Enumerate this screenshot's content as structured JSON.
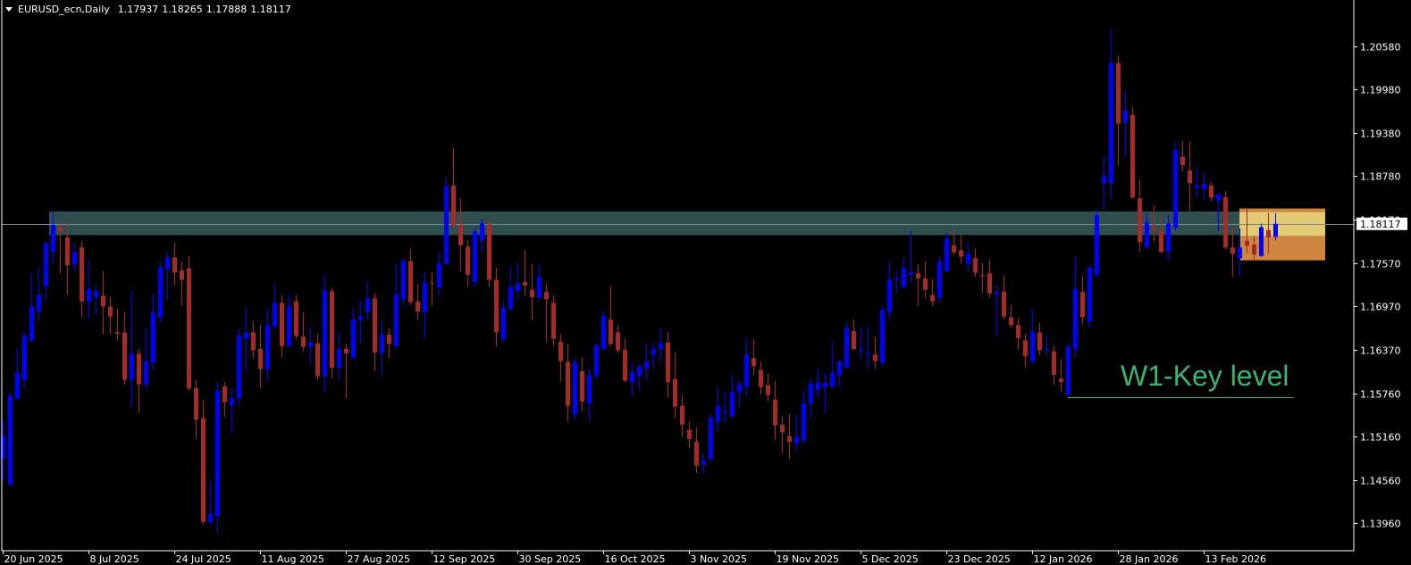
{
  "header": {
    "symbol_timeframe": "EURUSD_ecn,Daily",
    "open": "1.17937",
    "high": "1.18265",
    "low": "1.17888",
    "close": "1.18117"
  },
  "colors": {
    "background": "#000000",
    "bull": "#0000FF",
    "bear": "#A52A2A",
    "zone": "#2F4F4F",
    "box_outer": "#CD853F",
    "box_inner": "#E2CB72",
    "key_level": "#3CB371",
    "price_line": "#778899",
    "axis": "#FFFFFF"
  },
  "chart_data": {
    "type": "candlestick",
    "title": "EURUSD_ecn,Daily",
    "ylim": [
      1.1358,
      1.2122
    ],
    "y_ticks": [
      "1.20580",
      "1.19980",
      "1.19380",
      "1.18780",
      "1.18170",
      "1.17570",
      "1.16970",
      "1.16370",
      "1.15760",
      "1.15160",
      "1.14560",
      "1.13960"
    ],
    "x_ticks": [
      {
        "bar": 0,
        "label": "20 Jun 2025"
      },
      {
        "bar": 12,
        "label": "8 Jul 2025"
      },
      {
        "bar": 24,
        "label": "24 Jul 2025"
      },
      {
        "bar": 36,
        "label": "11 Aug 2025"
      },
      {
        "bar": 48,
        "label": "27 Aug 2025"
      },
      {
        "bar": 60,
        "label": "12 Sep 2025"
      },
      {
        "bar": 72,
        "label": "30 Sep 2025"
      },
      {
        "bar": 84,
        "label": "16 Oct 2025"
      },
      {
        "bar": 96,
        "label": "3 Nov 2025"
      },
      {
        "bar": 108,
        "label": "19 Nov 2025"
      },
      {
        "bar": 120,
        "label": "5 Dec 2025"
      },
      {
        "bar": 132,
        "label": "23 Dec 2025"
      },
      {
        "bar": 144,
        "label": "12 Jan 2026"
      },
      {
        "bar": 156,
        "label": "28 Jan 2026"
      },
      {
        "bar": 168,
        "label": "13 Feb 2026"
      }
    ],
    "current_price": "1.18117",
    "ohlc_format": [
      "open",
      "high",
      "low",
      "close"
    ],
    "candles": [
      [
        1.1486,
        1.1539,
        1.1455,
        1.1517
      ],
      [
        1.145,
        1.1578,
        1.1447,
        1.1573
      ],
      [
        1.1569,
        1.1638,
        1.1566,
        1.1605
      ],
      [
        1.1595,
        1.1662,
        1.1585,
        1.1656
      ],
      [
        1.165,
        1.1743,
        1.1647,
        1.1697
      ],
      [
        1.169,
        1.1751,
        1.1677,
        1.1713
      ],
      [
        1.1725,
        1.1786,
        1.1704,
        1.1785
      ],
      [
        1.1773,
        1.1829,
        1.1757,
        1.181
      ],
      [
        1.1807,
        1.1816,
        1.1743,
        1.1801
      ],
      [
        1.1793,
        1.1816,
        1.1713,
        1.1754
      ],
      [
        1.1755,
        1.1785,
        1.1747,
        1.1772
      ],
      [
        1.1779,
        1.1788,
        1.1682,
        1.1704
      ],
      [
        1.1704,
        1.1762,
        1.1679,
        1.1721
      ],
      [
        1.171,
        1.1726,
        1.1686,
        1.1718
      ],
      [
        1.1712,
        1.1746,
        1.1658,
        1.1697
      ],
      [
        1.1697,
        1.171,
        1.1659,
        1.1683
      ],
      [
        1.1661,
        1.1694,
        1.165,
        1.1659
      ],
      [
        1.1661,
        1.1689,
        1.1588,
        1.1595
      ],
      [
        1.1595,
        1.1719,
        1.1557,
        1.1631
      ],
      [
        1.1631,
        1.1638,
        1.155,
        1.1589
      ],
      [
        1.1589,
        1.1668,
        1.1581,
        1.1621
      ],
      [
        1.1619,
        1.1714,
        1.1609,
        1.1688
      ],
      [
        1.1682,
        1.1759,
        1.1674,
        1.1751
      ],
      [
        1.1749,
        1.1772,
        1.1707,
        1.1765
      ],
      [
        1.1765,
        1.1786,
        1.1726,
        1.1744
      ],
      [
        1.1747,
        1.1759,
        1.1698,
        1.1734
      ],
      [
        1.175,
        1.1767,
        1.158,
        1.1583
      ],
      [
        1.1584,
        1.1595,
        1.1513,
        1.154
      ],
      [
        1.1542,
        1.1568,
        1.1394,
        1.1398
      ],
      [
        1.1398,
        1.1455,
        1.1394,
        1.1409
      ],
      [
        1.1406,
        1.1592,
        1.1384,
        1.158
      ],
      [
        1.1586,
        1.1592,
        1.1544,
        1.1564
      ],
      [
        1.156,
        1.1584,
        1.1522,
        1.157
      ],
      [
        1.1569,
        1.1666,
        1.1558,
        1.1656
      ],
      [
        1.1652,
        1.1695,
        1.1606,
        1.1661
      ],
      [
        1.1661,
        1.1677,
        1.1625,
        1.1636
      ],
      [
        1.1638,
        1.1672,
        1.1584,
        1.161
      ],
      [
        1.1609,
        1.1694,
        1.1594,
        1.1671
      ],
      [
        1.1669,
        1.1728,
        1.1663,
        1.1702
      ],
      [
        1.1702,
        1.1713,
        1.1626,
        1.1642
      ],
      [
        1.1642,
        1.1713,
        1.1641,
        1.1697
      ],
      [
        1.1704,
        1.1713,
        1.1652,
        1.1656
      ],
      [
        1.1655,
        1.1689,
        1.1635,
        1.1641
      ],
      [
        1.1641,
        1.1669,
        1.1616,
        1.1647
      ],
      [
        1.1646,
        1.1659,
        1.1596,
        1.16
      ],
      [
        1.16,
        1.174,
        1.1578,
        1.1719
      ],
      [
        1.1718,
        1.1723,
        1.1597,
        1.1612
      ],
      [
        1.1612,
        1.1662,
        1.1596,
        1.1638
      ],
      [
        1.1638,
        1.1645,
        1.1569,
        1.1632
      ],
      [
        1.1626,
        1.1694,
        1.1624,
        1.1679
      ],
      [
        1.1678,
        1.1705,
        1.1646,
        1.1683
      ],
      [
        1.1689,
        1.1733,
        1.1678,
        1.1708
      ],
      [
        1.1708,
        1.1715,
        1.1607,
        1.1633
      ],
      [
        1.1632,
        1.1679,
        1.1602,
        1.1658
      ],
      [
        1.1658,
        1.1666,
        1.1625,
        1.1645
      ],
      [
        1.1642,
        1.1757,
        1.1637,
        1.1714
      ],
      [
        1.1707,
        1.1764,
        1.1699,
        1.176
      ],
      [
        1.176,
        1.1777,
        1.1699,
        1.1703
      ],
      [
        1.1704,
        1.1728,
        1.1678,
        1.169
      ],
      [
        1.1689,
        1.1744,
        1.1653,
        1.173
      ],
      [
        1.173,
        1.1745,
        1.1697,
        1.1729
      ],
      [
        1.1723,
        1.1772,
        1.1712,
        1.1757
      ],
      [
        1.1756,
        1.1877,
        1.1754,
        1.1864
      ],
      [
        1.1865,
        1.1917,
        1.1805,
        1.181
      ],
      [
        1.181,
        1.1847,
        1.1746,
        1.1782
      ],
      [
        1.178,
        1.179,
        1.1724,
        1.1741
      ],
      [
        1.1731,
        1.1806,
        1.1723,
        1.1801
      ],
      [
        1.1788,
        1.1818,
        1.1772,
        1.1812
      ],
      [
        1.1811,
        1.1817,
        1.1724,
        1.1734
      ],
      [
        1.1734,
        1.1751,
        1.1641,
        1.1661
      ],
      [
        1.1652,
        1.1704,
        1.1647,
        1.1695
      ],
      [
        1.1694,
        1.1752,
        1.169,
        1.1724
      ],
      [
        1.1718,
        1.1759,
        1.1708,
        1.1729
      ],
      [
        1.1731,
        1.1776,
        1.1712,
        1.1726
      ],
      [
        1.172,
        1.1756,
        1.1678,
        1.171
      ],
      [
        1.1709,
        1.1756,
        1.1707,
        1.1738
      ],
      [
        1.1717,
        1.1728,
        1.1647,
        1.1707
      ],
      [
        1.1702,
        1.1712,
        1.1642,
        1.1652
      ],
      [
        1.1648,
        1.1658,
        1.1592,
        1.1621
      ],
      [
        1.162,
        1.1645,
        1.1537,
        1.1559
      ],
      [
        1.1547,
        1.1627,
        1.154,
        1.1619
      ],
      [
        1.1607,
        1.1626,
        1.1552,
        1.1565
      ],
      [
        1.1562,
        1.1611,
        1.1537,
        1.1602
      ],
      [
        1.1601,
        1.1645,
        1.1596,
        1.1643
      ],
      [
        1.1638,
        1.1692,
        1.1637,
        1.1684
      ],
      [
        1.1679,
        1.1725,
        1.1642,
        1.1645
      ],
      [
        1.1661,
        1.1672,
        1.1633,
        1.1636
      ],
      [
        1.1637,
        1.1652,
        1.1592,
        1.1594
      ],
      [
        1.1592,
        1.1619,
        1.1571,
        1.1606
      ],
      [
        1.16,
        1.1616,
        1.158,
        1.1614
      ],
      [
        1.1611,
        1.1646,
        1.1595,
        1.1621
      ],
      [
        1.163,
        1.1648,
        1.1612,
        1.1638
      ],
      [
        1.1638,
        1.1666,
        1.1621,
        1.1646
      ],
      [
        1.1647,
        1.1662,
        1.1571,
        1.1592
      ],
      [
        1.1596,
        1.1633,
        1.1542,
        1.1558
      ],
      [
        1.1559,
        1.1574,
        1.1516,
        1.1533
      ],
      [
        1.1526,
        1.1537,
        1.15,
        1.1513
      ],
      [
        1.1509,
        1.1529,
        1.1466,
        1.1476
      ],
      [
        1.1477,
        1.1493,
        1.1465,
        1.1483
      ],
      [
        1.1485,
        1.1548,
        1.1482,
        1.1542
      ],
      [
        1.1537,
        1.1586,
        1.1523,
        1.1559
      ],
      [
        1.155,
        1.1579,
        1.1535,
        1.1552
      ],
      [
        1.1544,
        1.1602,
        1.1542,
        1.1578
      ],
      [
        1.1578,
        1.1594,
        1.1558,
        1.1589
      ],
      [
        1.1586,
        1.1653,
        1.1573,
        1.163
      ],
      [
        1.1625,
        1.1651,
        1.1601,
        1.1614
      ],
      [
        1.1609,
        1.1621,
        1.1576,
        1.1585
      ],
      [
        1.1588,
        1.1604,
        1.1566,
        1.1574
      ],
      [
        1.1568,
        1.1594,
        1.1512,
        1.1532
      ],
      [
        1.1533,
        1.1545,
        1.1493,
        1.1522
      ],
      [
        1.1517,
        1.1548,
        1.1485,
        1.1509
      ],
      [
        1.1507,
        1.1547,
        1.1496,
        1.1516
      ],
      [
        1.1511,
        1.1581,
        1.1506,
        1.1563
      ],
      [
        1.1562,
        1.1596,
        1.1542,
        1.159
      ],
      [
        1.1581,
        1.161,
        1.157,
        1.1591
      ],
      [
        1.1585,
        1.1604,
        1.1549,
        1.1591
      ],
      [
        1.1586,
        1.1648,
        1.1584,
        1.1605
      ],
      [
        1.1601,
        1.1622,
        1.1586,
        1.1621
      ],
      [
        1.1612,
        1.1674,
        1.161,
        1.1667
      ],
      [
        1.1663,
        1.1679,
        1.1636,
        1.1638
      ],
      [
        1.1635,
        1.1668,
        1.1624,
        1.1637
      ],
      [
        1.163,
        1.1669,
        1.1611,
        1.1632
      ],
      [
        1.163,
        1.1655,
        1.161,
        1.1621
      ],
      [
        1.1619,
        1.1697,
        1.1614,
        1.1692
      ],
      [
        1.1689,
        1.176,
        1.1677,
        1.1734
      ],
      [
        1.1734,
        1.1747,
        1.1715,
        1.1736
      ],
      [
        1.1724,
        1.1766,
        1.1721,
        1.175
      ],
      [
        1.1741,
        1.1802,
        1.173,
        1.1744
      ],
      [
        1.1743,
        1.1756,
        1.1698,
        1.1736
      ],
      [
        1.1736,
        1.176,
        1.1708,
        1.172
      ],
      [
        1.1713,
        1.1735,
        1.1698,
        1.1704
      ],
      [
        1.1709,
        1.1766,
        1.1702,
        1.1759
      ],
      [
        1.1746,
        1.18,
        1.1745,
        1.1791
      ],
      [
        1.1782,
        1.1806,
        1.1769,
        1.1772
      ],
      [
        1.1775,
        1.1795,
        1.1757,
        1.1766
      ],
      [
        1.1756,
        1.1787,
        1.1745,
        1.177
      ],
      [
        1.1764,
        1.1777,
        1.1738,
        1.1744
      ],
      [
        1.1741,
        1.1757,
        1.1715,
        1.174
      ],
      [
        1.1743,
        1.1762,
        1.1709,
        1.1715
      ],
      [
        1.1714,
        1.1726,
        1.1655,
        1.1717
      ],
      [
        1.1718,
        1.174,
        1.1679,
        1.1683
      ],
      [
        1.1682,
        1.1699,
        1.1668,
        1.1671
      ],
      [
        1.1671,
        1.1681,
        1.1637,
        1.1653
      ],
      [
        1.165,
        1.1659,
        1.1612,
        1.1628
      ],
      [
        1.1621,
        1.1695,
        1.1616,
        1.1662
      ],
      [
        1.1661,
        1.1674,
        1.1629,
        1.1636
      ],
      [
        1.1636,
        1.1658,
        1.163,
        1.1638
      ],
      [
        1.1635,
        1.1643,
        1.1588,
        1.1602
      ],
      [
        1.1597,
        1.1624,
        1.1579,
        1.1592
      ],
      [
        1.1575,
        1.1646,
        1.1571,
        1.1641
      ],
      [
        1.1638,
        1.1766,
        1.1627,
        1.1721
      ],
      [
        1.1717,
        1.174,
        1.1672,
        1.1682
      ],
      [
        1.1676,
        1.1754,
        1.1666,
        1.1751
      ],
      [
        1.1741,
        1.1832,
        1.1738,
        1.1824
      ],
      [
        1.1868,
        1.1906,
        1.1832,
        1.1878
      ],
      [
        1.1868,
        1.2082,
        1.1847,
        1.2035
      ],
      [
        1.2035,
        1.2045,
        1.1893,
        1.1951
      ],
      [
        1.1952,
        1.1996,
        1.1904,
        1.1969
      ],
      [
        1.1963,
        1.1974,
        1.1847,
        1.1848
      ],
      [
        1.1847,
        1.1873,
        1.1772,
        1.1786
      ],
      [
        1.1779,
        1.1827,
        1.1776,
        1.1814
      ],
      [
        1.1807,
        1.1837,
        1.1787,
        1.1803
      ],
      [
        1.1801,
        1.1819,
        1.1771,
        1.1773
      ],
      [
        1.1773,
        1.1824,
        1.1761,
        1.1812
      ],
      [
        1.1806,
        1.1925,
        1.1802,
        1.1914
      ],
      [
        1.1905,
        1.1927,
        1.1884,
        1.1893
      ],
      [
        1.1886,
        1.1926,
        1.1829,
        1.1868
      ],
      [
        1.1862,
        1.1889,
        1.1849,
        1.1865
      ],
      [
        1.186,
        1.1884,
        1.1844,
        1.1867
      ],
      [
        1.1865,
        1.1869,
        1.1843,
        1.1848
      ],
      [
        1.1844,
        1.1854,
        1.1801,
        1.1853
      ],
      [
        1.1849,
        1.1857,
        1.1777,
        1.1779
      ],
      [
        1.1779,
        1.1807,
        1.1738,
        1.177
      ],
      [
        1.1764,
        1.1805,
        1.1739,
        1.1779
      ],
      [
        1.1788,
        1.1834,
        1.1771,
        1.1781
      ],
      [
        1.1783,
        1.1795,
        1.1762,
        1.1769
      ],
      [
        1.1767,
        1.1812,
        1.1766,
        1.1807
      ],
      [
        1.1803,
        1.1827,
        1.177,
        1.1793
      ],
      [
        1.17937,
        1.18265,
        1.17888,
        1.18117
      ]
    ],
    "zones": {
      "resistance_zone": {
        "price_top": 1.1829,
        "price_bottom": 1.1796,
        "start_bar": 6.5,
        "end_bar": 173
      },
      "forecast_box": {
        "price_top": 1.1833,
        "price_bottom": 1.1761,
        "inner_top": 1.1828,
        "inner_bottom": 1.1795,
        "start_bar": 173,
        "end_bar": 185
      }
    },
    "key_level": {
      "label": "W1-Key level",
      "price": 1.1571,
      "start_bar": 149,
      "end_bar": 180.6
    }
  }
}
